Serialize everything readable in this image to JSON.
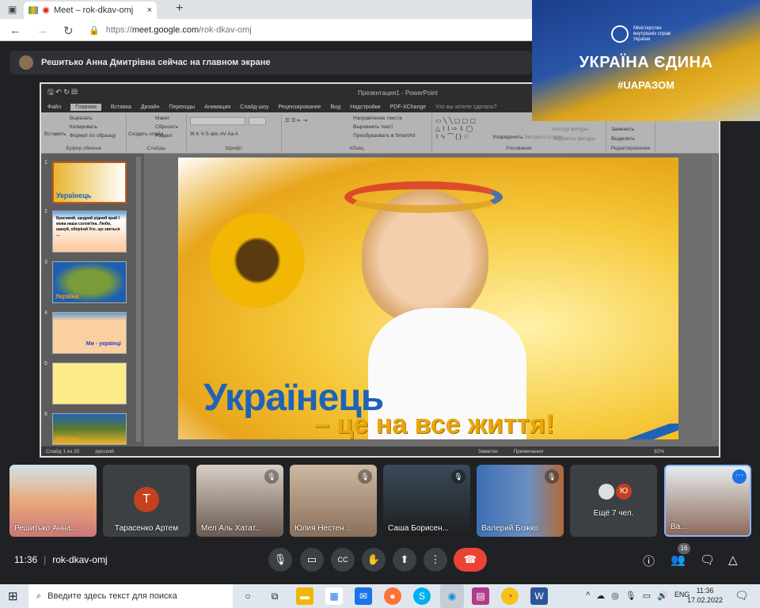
{
  "browser": {
    "tab_title": "Meet – rok-dkav-omj",
    "url_prefix": "https://",
    "url_domain": "meet.google.com",
    "url_path": "/rok-dkav-omj",
    "new_tab": "+",
    "close": "×"
  },
  "meet": {
    "presenting_banner": "Решитько Анна Дмитрівна сейчас на главном экране",
    "time": "11:36",
    "meeting_code": "rok-dkav-omj",
    "people_count": "16",
    "more_people": "Ещё 7 чел.",
    "more_avatar_letter": "Ю"
  },
  "overlay": {
    "ministry": "Міністерство внутрішніх справ України",
    "title": "УКРАЇНА ЄДИНА",
    "hashtag": "#UAРАЗОМ"
  },
  "powerpoint": {
    "title": "Презентация1 - PowerPoint",
    "tabs": [
      "Файл",
      "Главная",
      "Вставка",
      "Дизайн",
      "Переходы",
      "Анимация",
      "Слайд-шоу",
      "Рецензирование",
      "Вид",
      "Надстройки",
      "PDF-XChange",
      "Что вы хотите сделать?"
    ],
    "ribbon": {
      "clipboard": {
        "label": "Буфер обмена",
        "paste": "Вставить",
        "cut": "Вырезать",
        "copy": "Копировать",
        "format": "Формат по образцу"
      },
      "slides": {
        "label": "Слайды",
        "new": "Создать слайд",
        "layout": "Макет",
        "reset": "Сбросить",
        "section": "Раздел"
      },
      "font": {
        "label": "Шрифт"
      },
      "paragraph": {
        "label": "Абзац",
        "direction": "Направление текста",
        "align": "Выровнять текст",
        "smartart": "Преобразовать в SmartArt"
      },
      "drawing": {
        "label": "Рисование",
        "arrange": "Упорядочить",
        "styles": "Экспресс-стили",
        "outline": "Контур фигуры",
        "effects": "Эффекты фигуры"
      },
      "editing": {
        "label": "Редактирование",
        "replace": "Заменить",
        "select": "Выделить"
      }
    },
    "thumbnails": [
      {
        "n": "1",
        "text": "Українець"
      },
      {
        "n": "2",
        "text": "Красивий, щедрий рідний край І мова наша солов'їна. Люби, шануй, оберігай Усе, що зветься ..."
      },
      {
        "n": "3",
        "text": "Україна"
      },
      {
        "n": "4",
        "text": "Ми - українці"
      },
      {
        "n": "5",
        "text": ""
      },
      {
        "n": "6",
        "text": "Україна"
      }
    ],
    "slide": {
      "title": "Українець",
      "subtitle": "– це на все життя!"
    },
    "status": {
      "slide": "Слайд 1 из 20",
      "lang": "русский",
      "notes": "Заметки",
      "comments": "Примечания",
      "zoom": "92%"
    }
  },
  "participants": [
    {
      "name": "Решитько Анна...",
      "muted": false
    },
    {
      "name": "Тарасенко Артем",
      "avatar": "Т",
      "muted": false
    },
    {
      "name": "Мел Аль Хатат...",
      "muted": true
    },
    {
      "name": "Юлия Нестен...",
      "muted": true
    },
    {
      "name": "Саша Борисен...",
      "muted": true
    },
    {
      "name": "Валерий Божко",
      "muted": true
    },
    {
      "name": "Ва...",
      "muted": false
    }
  ],
  "taskbar": {
    "search_placeholder": "Введите здесь текст для поиска",
    "lang": "ENG",
    "time": "11:36",
    "date": "17.02.2022"
  },
  "colors": {
    "meet_bg": "#202124",
    "end_call": "#ea4335",
    "accent": "#8ab4f8",
    "avatar_t": "#c5401f"
  }
}
